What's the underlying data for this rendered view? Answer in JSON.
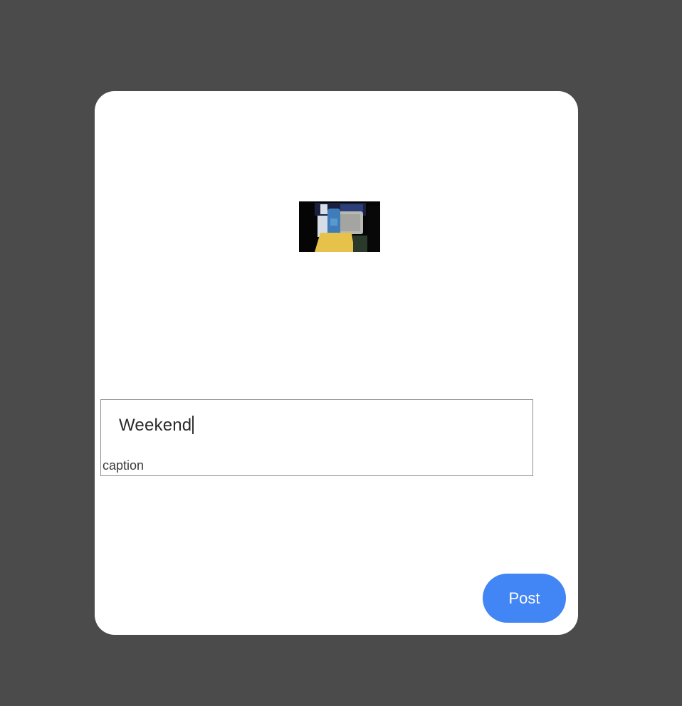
{
  "dialog": {
    "thumbnail": {
      "icon": "photo-thumbnail"
    },
    "caption_field": {
      "value": "Weekend",
      "label": "caption"
    },
    "post_label": "Post"
  },
  "colors": {
    "backdrop": "#4b4b4b",
    "dialog_background": "#ffffff",
    "accent": "#4285f4",
    "field_border": "#8e8e8e"
  }
}
